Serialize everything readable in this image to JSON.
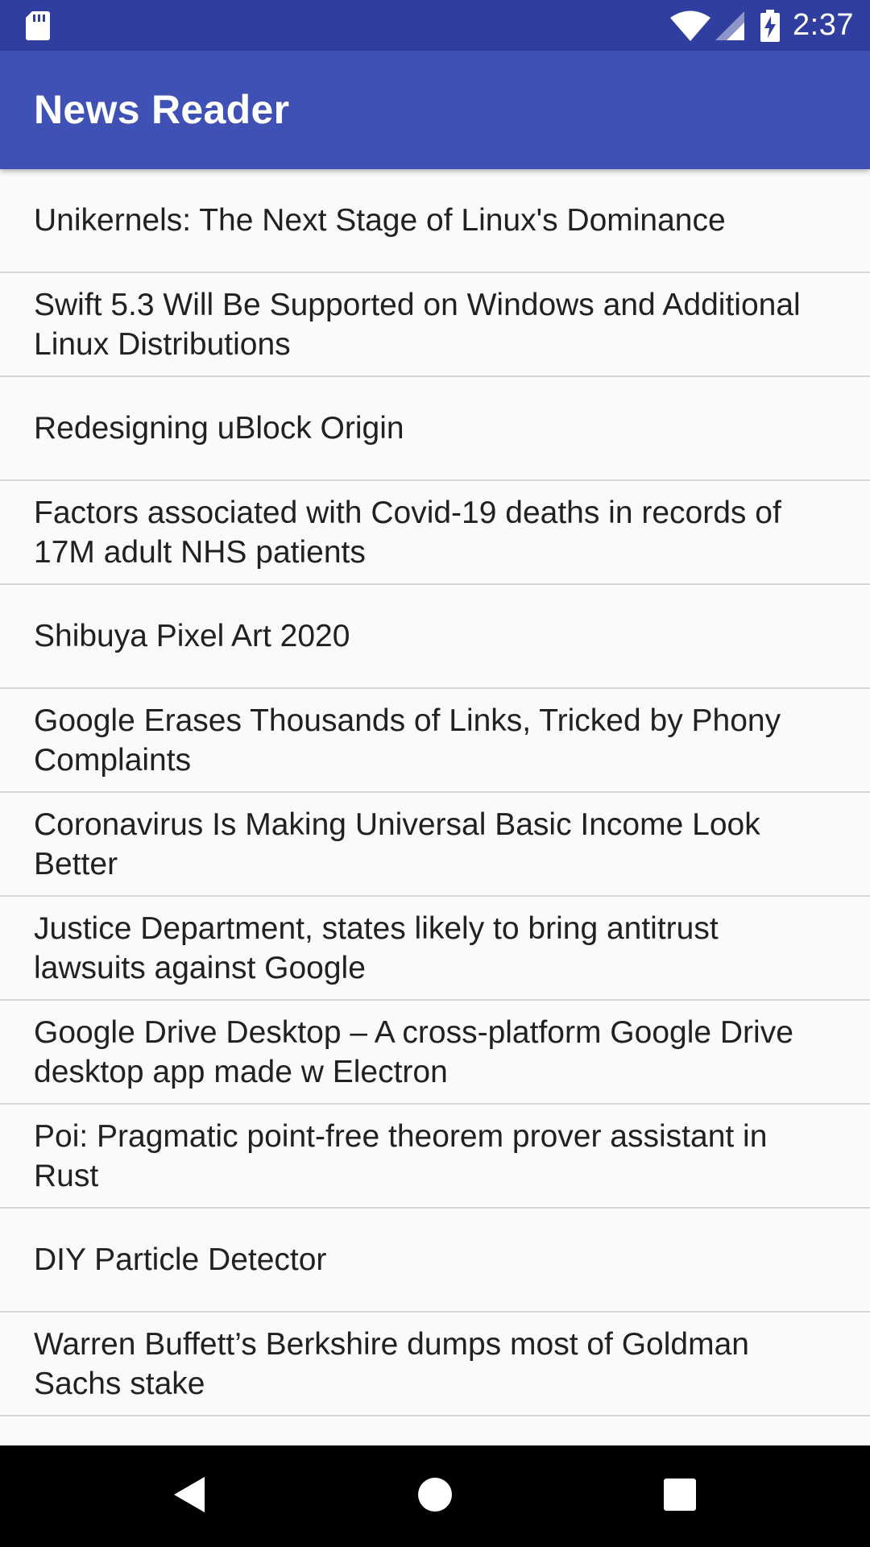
{
  "status_bar": {
    "time": "2:37",
    "icons": [
      "sd-card-icon",
      "wifi-icon",
      "cell-signal-icon",
      "battery-charging-icon"
    ]
  },
  "app_bar": {
    "title": "News Reader"
  },
  "news": {
    "items": [
      {
        "title": "Unikernels: The Next Stage of Linux's Dominance"
      },
      {
        "title": "Swift 5.3 Will Be Supported on Windows and Additional Linux Distributions"
      },
      {
        "title": "Redesigning uBlock Origin"
      },
      {
        "title": "Factors associated with Covid-19 deaths in records of 17M adult NHS patients"
      },
      {
        "title": "Shibuya Pixel Art 2020"
      },
      {
        "title": "Google Erases Thousands of Links, Tricked by Phony Complaints"
      },
      {
        "title": "Coronavirus Is Making Universal Basic Income Look Better"
      },
      {
        "title": "Justice Department, states likely to bring antitrust lawsuits against Google"
      },
      {
        "title": "Google Drive Desktop – A cross-platform Google Drive desktop app made w Electron"
      },
      {
        "title": "Poi: Pragmatic point-free theorem prover assistant in Rust"
      },
      {
        "title": "DIY Particle Detector"
      },
      {
        "title": "Warren Buffett’s Berkshire dumps most of Goldman Sachs stake"
      },
      {
        "title": ""
      }
    ]
  },
  "nav_bar": {
    "icons": [
      "back-icon",
      "home-icon",
      "recents-icon"
    ]
  },
  "colors": {
    "status_bar": "#303f9f",
    "app_bar": "#3f51b5",
    "background": "#fafafa",
    "divider": "#d6d6d6",
    "text": "#212121"
  }
}
